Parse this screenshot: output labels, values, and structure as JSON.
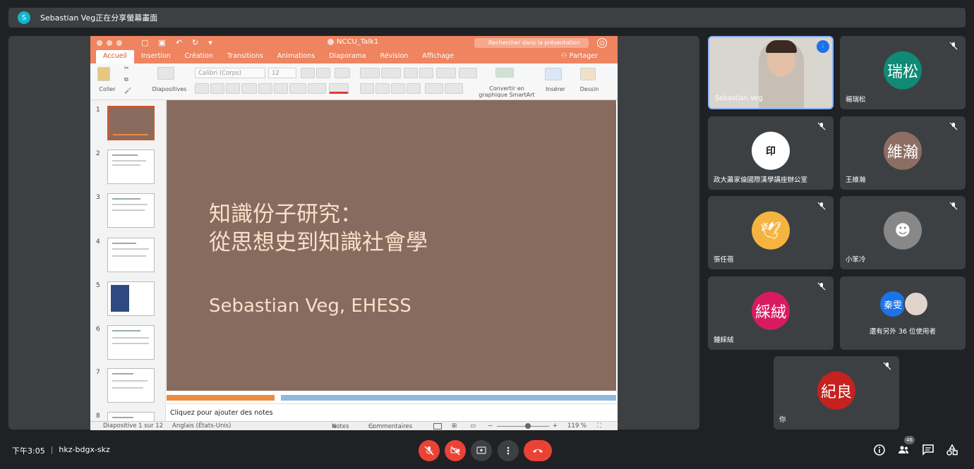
{
  "meet": {
    "presenting_banner": "Sebastian Veg正在分享螢幕畫面",
    "presenter_initial": "S",
    "clock": "下午3:05",
    "separator": "|",
    "meeting_code": "hkz-bdgx-skz",
    "participant_count": "46",
    "colors": {
      "bg": "#202124",
      "tile": "#3c4043",
      "danger": "#ea4335",
      "accent": "#12b5cb"
    }
  },
  "ppt": {
    "doc_title": "NCCU_Talk1",
    "search_placeholder": "Rechercher dans la présentation",
    "share": "Partager",
    "tabs": [
      "Accueil",
      "Insertion",
      "Création",
      "Transitions",
      "Animations",
      "Diaporama",
      "Révision",
      "Affichage"
    ],
    "ribbon": {
      "paste": "Coller",
      "layouts": "Diapositives",
      "font": "Calibri (Corps)",
      "size": "12",
      "smartart": "Convertir en\ngraphique SmartArt",
      "insert": "Insérer",
      "draw": "Dessin"
    },
    "thumb_numbers": [
      "1",
      "2",
      "3",
      "4",
      "5",
      "6",
      "7",
      "8"
    ],
    "slide": {
      "title": "知識份子研究：\n從思想史到知識社會學",
      "author": "Sebastian Veg, EHESS"
    },
    "notes_placeholder": "Cliquez pour ajouter des notes",
    "status": {
      "slide": "Diapositive 1 sur 12",
      "language": "Anglais (États-Unis)",
      "notes": "Notes",
      "comments": "Commentaires",
      "zoom_minus": "−",
      "zoom_plus": "+",
      "zoom": "119 %",
      "zoom_level": 0.6
    }
  },
  "participants": [
    {
      "name": "Sebastian Veg",
      "bubble": "",
      "color": "#d9d5cf",
      "speaking": true
    },
    {
      "name": "楊瑞松",
      "bubble": "瑞松",
      "color": "#0f8a76"
    },
    {
      "name": "政大蕭家倫國際漢學講座辦公室",
      "bubble": "",
      "color": "#ffffff"
    },
    {
      "name": "王維瀚",
      "bubble": "維瀚",
      "color": "#8d6e63"
    },
    {
      "name": "張任蓓",
      "bubble": "",
      "color": "#f5b440"
    },
    {
      "name": "小笨冷",
      "bubble": "",
      "color": "#888888"
    },
    {
      "name": "鍾綵絨",
      "bubble": "綵絨",
      "color": "#d81b60"
    },
    {
      "name": "還有另外 36 位使用者",
      "bubble": "秦雯",
      "color": "#1a73e8"
    },
    {
      "name": "你",
      "bubble": "紀良",
      "color": "#c5221f"
    }
  ]
}
